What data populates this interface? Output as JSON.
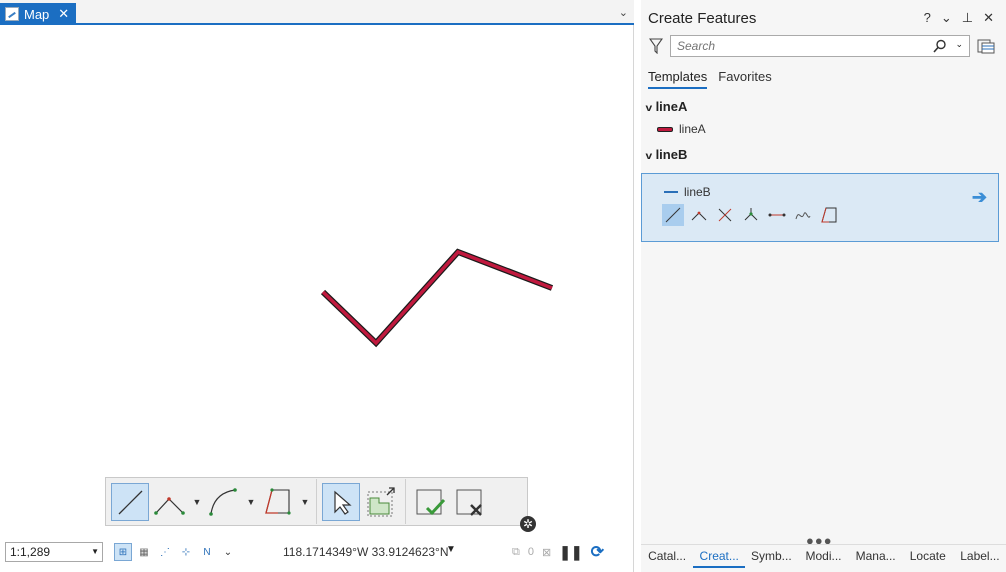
{
  "map": {
    "tab_label": "Map",
    "tab_close": "✕",
    "tab_dropdown": "⌄",
    "line_color": "#c0193e",
    "accent": "#1b6ec2"
  },
  "statusbar": {
    "scale": "1:1,289",
    "coordinates": "118.1714349°W 33.9124623°N",
    "selected_count": "0"
  },
  "panel": {
    "title": "Create Features",
    "help": "?",
    "menu": "⌄",
    "pin": "📌",
    "close": "✕",
    "search_placeholder": "Search",
    "tabs": [
      "Templates",
      "Favorites"
    ],
    "groups": [
      {
        "name": "lineA",
        "templates": [
          {
            "label": "lineA"
          }
        ]
      },
      {
        "name": "lineB",
        "templates": [
          {
            "label": "lineB"
          }
        ]
      }
    ],
    "bottom_tabs": [
      "Catal...",
      "Creat...",
      "Symb...",
      "Modi...",
      "Mana...",
      "Locate",
      "Label..."
    ],
    "active_bottom_tab": "Creat..."
  }
}
